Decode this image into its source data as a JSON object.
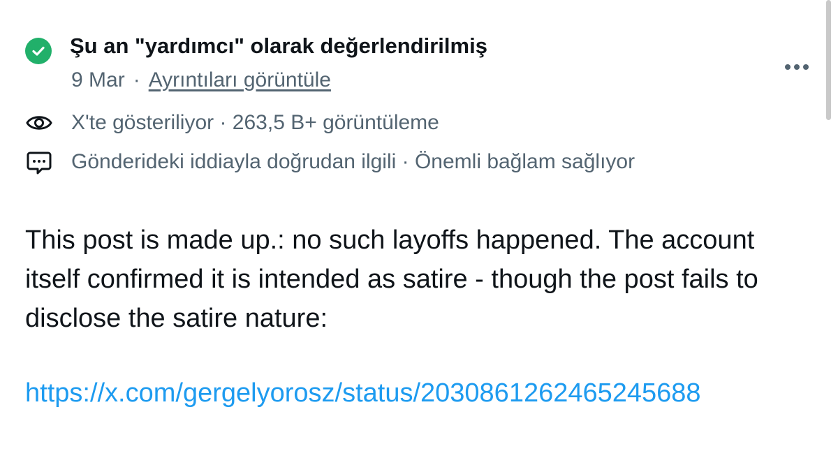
{
  "note_status": {
    "icon": "check-circle-icon",
    "icon_color": "#21b06a",
    "title": "Şu an \"yardımcı\" olarak değerlendirilmiş",
    "date": "9 Mar",
    "separator": "·",
    "details_link": "Ayrıntıları görüntüle"
  },
  "more_menu": {
    "icon": "more-horizontal-icon"
  },
  "info_rows": [
    {
      "icon": "eye-icon",
      "text": "X'te gösteriliyor · 263,5 B+ görüntüleme"
    },
    {
      "icon": "message-dots-icon",
      "text": "Gönderideki iddiayla doğrudan ilgili · Önemli bağlam sağlıyor"
    }
  ],
  "note": {
    "body": "This post is made up.: no such layoffs happened. The account itself confirmed it is intended as satire - though the post fails to disclose the satire nature:",
    "link": "https://x.com/gergelyorosz/status/2030861262465245688",
    "link_color": "#1d9bf0"
  }
}
